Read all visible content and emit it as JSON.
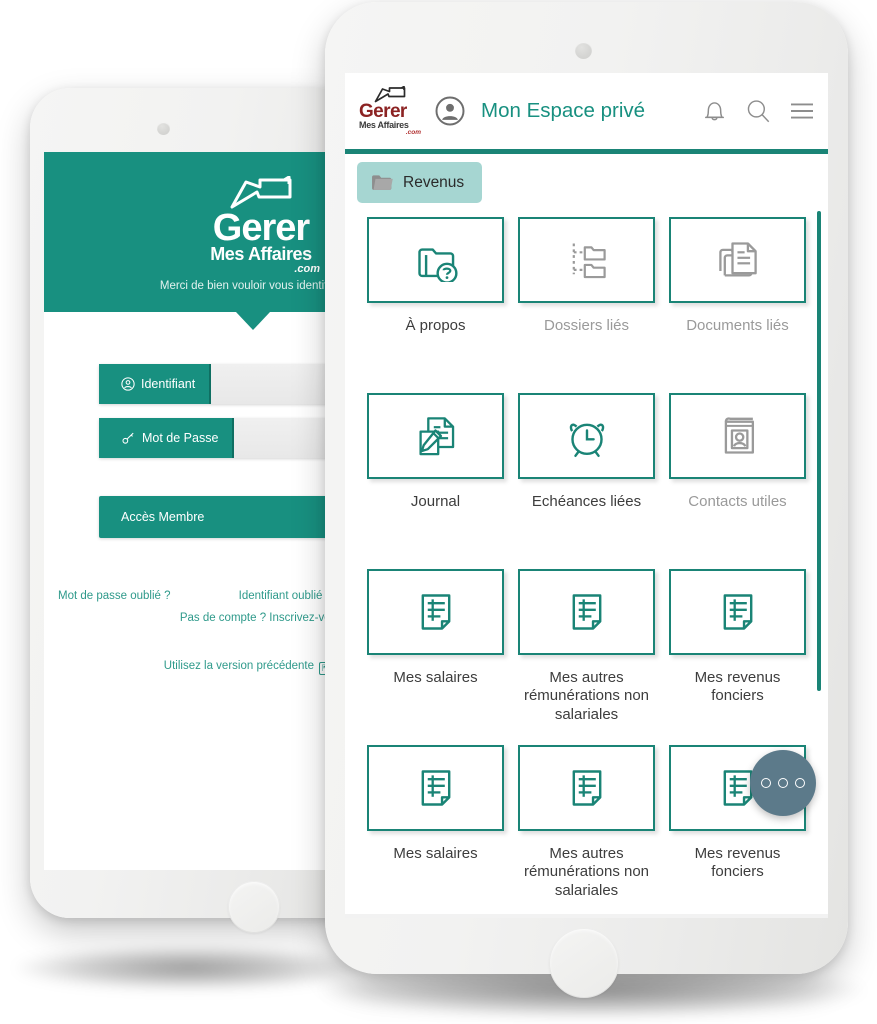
{
  "brand": {
    "accent_teal": "#189080",
    "rule_teal": "#1a8476",
    "tab_teal": "#a6d6d2",
    "logo_red": "#8c2323",
    "fab_slate": "#5c7a8a",
    "muted_grey": "#9a9a9a"
  },
  "logo": {
    "name_top": "Gerer",
    "name_bottom": "Mes Affaires",
    "tld": ".com",
    "folder_icon": "folder-outline-icon"
  },
  "login_screen": {
    "subtitle": "Merci de bien vouloir vous identifier",
    "fields": [
      {
        "label": "Identifiant",
        "icon": "user-circle-icon",
        "value": "",
        "placeholder": ""
      },
      {
        "label": "Mot de Passe",
        "icon": "key-icon",
        "value": "",
        "placeholder": ""
      }
    ],
    "submit_label": "Accès Membre",
    "links": {
      "forgot_password": "Mot de passe oublié ?",
      "forgot_identifier": "Identifiant oublié ?",
      "signup": "Pas de compte ? Inscrivez-vous.",
      "previous_version": "Utilisez la version précédente",
      "previous_version_icon": "external-link-icon"
    }
  },
  "app_screen": {
    "header": {
      "title": "Mon Espace privé",
      "avatar_icon": "user-avatar-icon",
      "icons": [
        {
          "name": "bell-icon",
          "label": "Notifications"
        },
        {
          "name": "search-icon",
          "label": "Rechercher"
        },
        {
          "name": "hamburger-menu-icon",
          "label": "Menu"
        }
      ]
    },
    "tab": {
      "label": "Revenus",
      "icon": "folder-icon"
    },
    "tiles": [
      {
        "label": "À propos",
        "icon": "folder-question-icon",
        "state": "active"
      },
      {
        "label": "Dossiers liés",
        "icon": "folder-tree-icon",
        "state": "muted"
      },
      {
        "label": "Documents liés",
        "icon": "documents-stack-icon",
        "state": "muted"
      },
      {
        "label": "Journal",
        "icon": "document-pencil-icon",
        "state": "active"
      },
      {
        "label": "Echéances liées",
        "icon": "alarm-clock-icon",
        "state": "active"
      },
      {
        "label": "Contacts utiles",
        "icon": "address-book-icon",
        "state": "muted"
      },
      {
        "label": "Mes salaires",
        "icon": "ledger-sheet-icon",
        "state": "active"
      },
      {
        "label": "Mes autres rémunérations non salariales",
        "icon": "ledger-sheet-icon",
        "state": "active"
      },
      {
        "label": "Mes revenus fonciers",
        "icon": "ledger-sheet-icon",
        "state": "active"
      },
      {
        "label": "Mes salaires",
        "icon": "ledger-sheet-icon",
        "state": "active"
      },
      {
        "label": "Mes autres rémunérations non salariales",
        "icon": "ledger-sheet-icon",
        "state": "active"
      },
      {
        "label": "Mes revenus fonciers",
        "icon": "ledger-sheet-icon",
        "state": "active"
      }
    ],
    "fab": {
      "icon": "three-dots-icon",
      "label": "Plus d'options"
    }
  }
}
